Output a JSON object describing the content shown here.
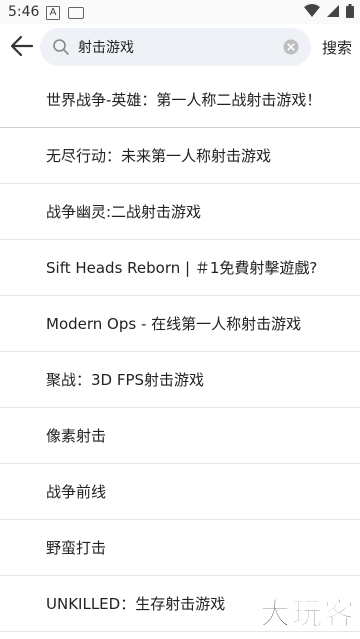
{
  "status_bar": {
    "time": "5:46",
    "notification_letter": "A"
  },
  "search": {
    "value": "射击游戏",
    "action_label": "搜索"
  },
  "suggestions": [
    "世界战争-英雄：第一人称二战射击游戏！",
    "无尽行动：未来第一人称射击游戏",
    "战争幽灵:二战射击游戏",
    "Sift Heads Reborn | ＃1免費射擊遊戲?",
    "Modern Ops - 在线第一人称射击游戏",
    "聚战：3D FPS射击游戏",
    "像素射击",
    "战争前线",
    "野蛮打击",
    "UNKILLED：生存射击游戏"
  ],
  "watermark": "大玩客",
  "colors": {
    "searchbox_bg": "#eef1f5",
    "divider": "#e6e6e6",
    "text": "#222222"
  }
}
